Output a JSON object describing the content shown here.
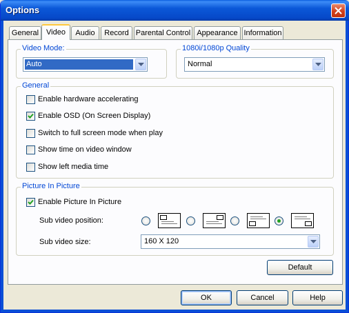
{
  "window": {
    "title": "Options"
  },
  "tabs": [
    "General",
    "Video",
    "Audio",
    "Record",
    "Parental Control",
    "Appearance",
    "Information"
  ],
  "video_mode": {
    "label": "Video Mode:",
    "value": "Auto"
  },
  "quality": {
    "label": "1080i/1080p Quality",
    "value": "Normal"
  },
  "general": {
    "label": "General",
    "options": [
      {
        "label": "Enable hardware accelerating",
        "checked": false
      },
      {
        "label": "Enable OSD (On Screen Display)",
        "checked": true
      },
      {
        "label": "Switch to full screen mode when play",
        "checked": false
      },
      {
        "label": "Show time on video window",
        "checked": false
      },
      {
        "label": "Show left media time",
        "checked": false
      }
    ]
  },
  "pip": {
    "label": "Picture In Picture",
    "enable_label": "Enable Picture In Picture",
    "enable_checked": true,
    "position_label": "Sub video position:",
    "positions": [
      "top-left",
      "top-right",
      "bottom-left",
      "bottom-right"
    ],
    "selected_position": "bottom-right",
    "size_label": "Sub video size:",
    "size_value": "160 X 120"
  },
  "buttons": {
    "default": "Default",
    "ok": "OK",
    "cancel": "Cancel",
    "help": "Help"
  }
}
